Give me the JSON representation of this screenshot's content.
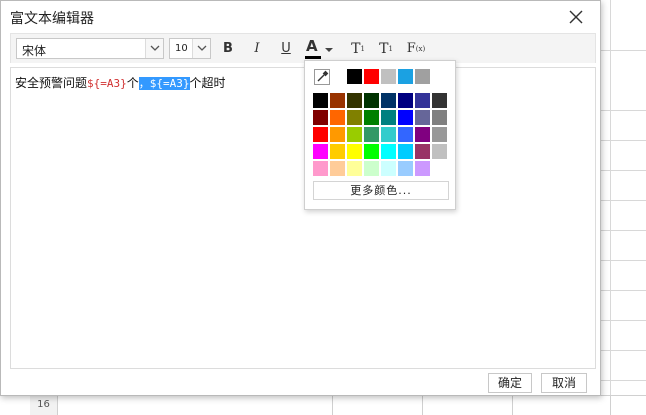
{
  "dialog": {
    "title": "富文本编辑器",
    "ok_label": "确定",
    "cancel_label": "取消"
  },
  "toolbar": {
    "font_family": "宋体",
    "font_size": "10",
    "bold_label": "B",
    "italic_label": "I",
    "underline_label": "U",
    "color_label": "A",
    "superscript_label": "T",
    "superscript_mark": "1",
    "subscript_label": "T",
    "subscript_mark": "1",
    "formula_label": "F",
    "formula_mark": "(x)"
  },
  "editor": {
    "text_before": "安全预警问题",
    "var1": "${=A3}",
    "text_mid": "个",
    "selected": "，${=A3}",
    "text_after": "个超时"
  },
  "color_picker": {
    "recent_colors": [
      "#000000",
      "#ff0000",
      "#c0c0c0",
      "#1ba1e2",
      "#a0a0a0",
      "#ffffff"
    ],
    "palette": [
      [
        "#000000",
        "#993300",
        "#333300",
        "#003300",
        "#003366",
        "#000080",
        "#333399",
        "#333333"
      ],
      [
        "#800000",
        "#ff6600",
        "#808000",
        "#008000",
        "#008080",
        "#0000ff",
        "#666699",
        "#808080"
      ],
      [
        "#ff0000",
        "#ff9900",
        "#99cc00",
        "#339966",
        "#33cccc",
        "#3366ff",
        "#800080",
        "#999999"
      ],
      [
        "#ff00ff",
        "#ffcc00",
        "#ffff00",
        "#00ff00",
        "#00ffff",
        "#00ccff",
        "#993366",
        "#c0c0c0"
      ],
      [
        "#ff99cc",
        "#ffcc99",
        "#ffff99",
        "#ccffcc",
        "#ccffff",
        "#99ccff",
        "#cc99ff",
        "#ffffff"
      ]
    ],
    "more_label": "更多颜色..."
  },
  "sheet": {
    "row_label": "16"
  }
}
